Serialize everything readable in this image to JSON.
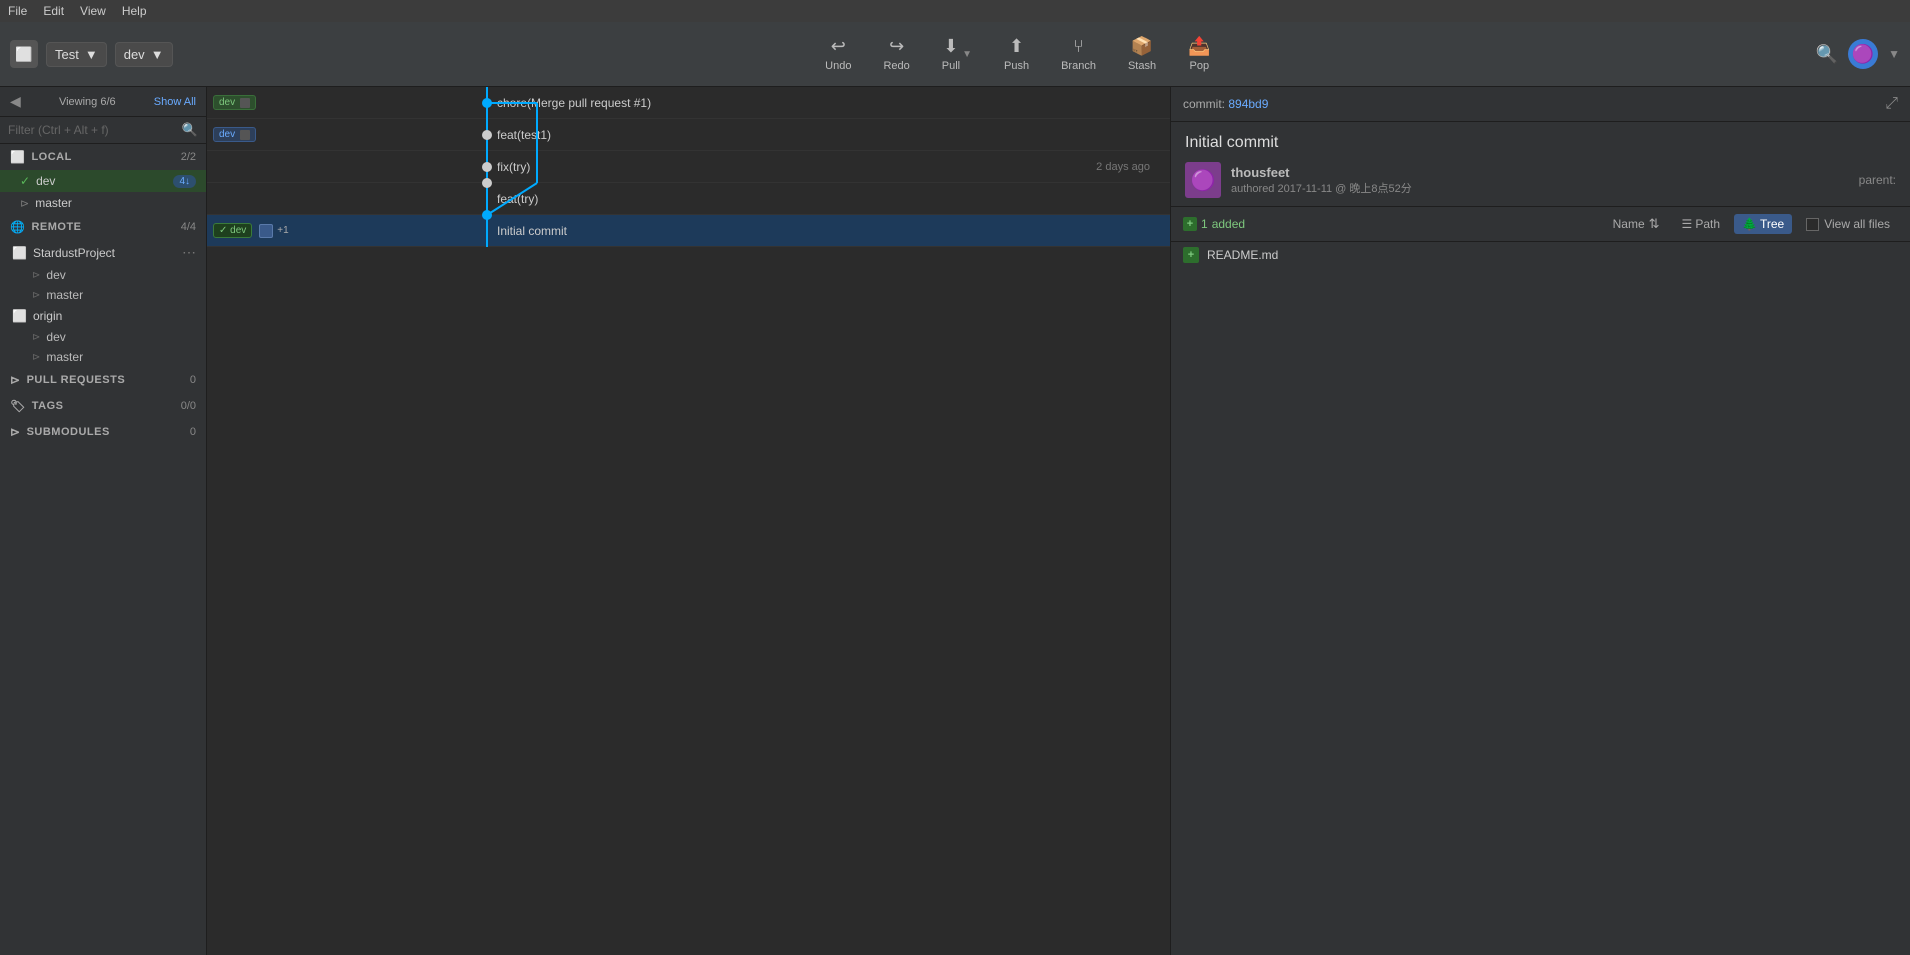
{
  "menu": {
    "items": [
      "File",
      "Edit",
      "View",
      "Help"
    ]
  },
  "toolbar": {
    "repo_name": "Test",
    "repo_dropdown_arrow": "▼",
    "branch_name": "dev",
    "branch_dropdown_arrow": "▼",
    "buttons": [
      {
        "id": "undo",
        "icon": "↩",
        "label": "Undo"
      },
      {
        "id": "redo",
        "icon": "↪",
        "label": "Redo"
      },
      {
        "id": "pull",
        "icon": "⬇",
        "label": "Pull",
        "has_dropdown": true
      },
      {
        "id": "push",
        "icon": "⬆",
        "label": "Push"
      },
      {
        "id": "branch",
        "icon": "⑂",
        "label": "Branch"
      },
      {
        "id": "stash",
        "icon": "📦",
        "label": "Stash"
      },
      {
        "id": "pop",
        "icon": "📤",
        "label": "Pop"
      }
    ]
  },
  "sidebar": {
    "back_label": "◀",
    "viewing_text": "Viewing 6/6",
    "show_all": "Show All",
    "filter_placeholder": "Filter (Ctrl + Alt + f)",
    "sections": {
      "local": {
        "title": "LOCAL",
        "count": "2/2",
        "items": [
          {
            "id": "dev",
            "label": "dev",
            "badge": "4↓",
            "active": true,
            "checked": true
          },
          {
            "id": "master",
            "label": "master",
            "active": false
          }
        ]
      },
      "remote": {
        "title": "REMOTE",
        "count": "4/4",
        "remotes": [
          {
            "id": "stardustproject",
            "label": "StardustProject",
            "branches": [
              "dev",
              "master"
            ]
          },
          {
            "id": "origin",
            "label": "origin",
            "branches": [
              "dev",
              "master"
            ]
          }
        ]
      },
      "pull_requests": {
        "title": "PULL REQUESTS",
        "count": "0"
      },
      "tags": {
        "title": "TAGS",
        "count": "0/0"
      },
      "submodules": {
        "title": "SUBMODULES",
        "count": "0"
      }
    }
  },
  "commits": [
    {
      "id": "c1",
      "message": "chore(Merge pull request #1)",
      "time": "",
      "tags": [
        {
          "label": "dev",
          "type": "local"
        },
        {
          "label": "⬜",
          "type": "remote"
        }
      ],
      "selected": false
    },
    {
      "id": "c2",
      "message": "feat(test1)",
      "time": "",
      "tags": [
        {
          "label": "dev",
          "type": "remote"
        }
      ],
      "selected": false
    },
    {
      "id": "c3",
      "message": "fix(try)",
      "time": "2 days ago",
      "tags": [],
      "selected": false
    },
    {
      "id": "c4",
      "message": "feat(try)",
      "time": "",
      "tags": [],
      "selected": false
    },
    {
      "id": "c5",
      "message": "Initial commit",
      "time": "",
      "tags": [
        {
          "label": "✓ dev",
          "type": "local-check"
        },
        {
          "label": "⬜",
          "type": "remote"
        },
        {
          "label": "+1",
          "type": "count"
        }
      ],
      "selected": true
    }
  ],
  "right_panel": {
    "commit_label": "commit:",
    "commit_hash": "894bd9",
    "commit_title": "Initial commit",
    "author": {
      "name": "thousfeet",
      "date": "authored 2017-11-11 @ 晚上8点52分"
    },
    "parent_label": "parent:",
    "parent_hash": "",
    "files_summary": {
      "added_count": "1",
      "added_label": "added"
    },
    "files_controls": {
      "name_col": "Name",
      "sort_icon": "⇅",
      "path_label": "Path",
      "tree_label": "Tree",
      "view_all_label": "View all files"
    },
    "files": [
      {
        "name": "README.md",
        "status": "+"
      }
    ]
  }
}
